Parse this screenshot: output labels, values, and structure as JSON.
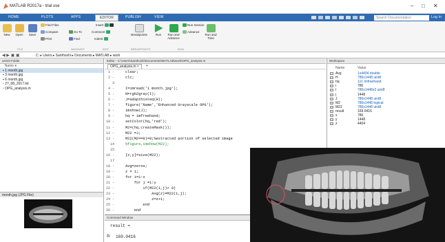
{
  "window": {
    "title": "MATLAB R2017a - trial use"
  },
  "tabs": [
    {
      "label": "HOME"
    },
    {
      "label": "PLOTS"
    },
    {
      "label": "APPS"
    },
    {
      "label": "EDITOR"
    },
    {
      "label": "PUBLISH"
    },
    {
      "label": "VIEW"
    }
  ],
  "search": {
    "placeholder": "Search Documentation"
  },
  "login": "Log In",
  "ribbon": {
    "new": "New",
    "open": "Open",
    "save": "Save",
    "find_files": "Find Files",
    "compare": "Compare",
    "print": "Print",
    "go_to": "Go To",
    "find": "Find",
    "insert": "Insert",
    "comment": "Comment",
    "indent": "Indent",
    "breakpoints": "Breakpoints",
    "run": "Run",
    "run_and_advance": "Run and Advance",
    "run_section": "Run Section",
    "advance": "Advance",
    "run_and_time": "Run and Time",
    "groups": [
      "FILE",
      "NAVIGATE",
      "EDIT",
      "BREAKPOINTS",
      "RUN"
    ]
  },
  "address": {
    "path": [
      "C:",
      "Users",
      "Santhoshi",
      "Documents",
      "MATLAB",
      "work"
    ]
  },
  "current_folder": {
    "title": "urrent Folder",
    "column": "Name",
    "files": [
      "1 month.jpg",
      "3 month.jpg",
      "6 month.jpg",
      "27_08_2017.txt",
      "OPG_analysis.m"
    ],
    "details_file": "month.jpg (JPG File)"
  },
  "editor": {
    "title": "Editor - C:\\Users\\Santhoshi\\Documents\\MATLAB\\work\\OPG_analysis.m",
    "tab": "OPG_analysis.m",
    "lines": [
      {
        "n": "1 -",
        "code": "clear;"
      },
      {
        "n": "2 -",
        "code": "clc;"
      },
      {
        "n": "3",
        "code": ""
      },
      {
        "n": "4 -",
        "code": "I=imread('1 month.jpg');"
      },
      {
        "n": "5 -",
        "code": "H=rgb2gray(I);"
      },
      {
        "n": "6 -",
        "code": "J=adapthisteq(H);"
      },
      {
        "n": "7 -",
        "code": "figure('Name','Enhanced Grayscale OPG');"
      },
      {
        "n": "8 -",
        "code": "imshow(J);"
      },
      {
        "n": "9 -",
        "code": "hq = imfreehand;"
      },
      {
        "n": "10 -",
        "code": "setColor(hq,'red');"
      },
      {
        "n": "11 -",
        "code": "M2=(hq.createMask());"
      },
      {
        "n": "12 -",
        "code": "M22 =J;"
      },
      {
        "n": "13 -",
        "code": "M22(M2==0)=0;%extracted portion of selected image"
      },
      {
        "n": "14",
        "code": "%figure,imshow(M22);"
      },
      {
        "n": "15",
        "code": ""
      },
      {
        "n": "16 -",
        "code": "[x,y]=size(M22);"
      },
      {
        "n": "17",
        "code": ""
      },
      {
        "n": "18 -",
        "code": "Avg=zeros;"
      },
      {
        "n": "19 -",
        "code": "z = 1;"
      },
      {
        "n": "20 -",
        "code": "for i=1:x"
      },
      {
        "n": "21 -",
        "code": "    for j =1:y"
      },
      {
        "n": "22 -",
        "code": "        if(M22(i,j)> 0)"
      },
      {
        "n": "23 -",
        "code": "            Avg(z)=M22(i,j);"
      },
      {
        "n": "24 -",
        "code": "            z=z+1;"
      },
      {
        "n": "25 -",
        "code": "        end"
      },
      {
        "n": "26 -",
        "code": "    end"
      }
    ]
  },
  "command_window": {
    "title": "Command Window",
    "line1": "result =",
    "line2": "169.0416",
    "prompt": "fx"
  },
  "workspace": {
    "title": "Workspace",
    "col_name": "Name",
    "col_value": "Value",
    "vars": [
      {
        "name": "Avg",
        "value": "1x4404 double"
      },
      {
        "name": "H",
        "value": "786x1448 uint8"
      },
      {
        "name": "hq",
        "value": "1x1 imfreehand"
      },
      {
        "name": "i",
        "value": "786"
      },
      {
        "name": "I",
        "value": "786x1448x3 uint8"
      },
      {
        "name": "j",
        "value": "1448"
      },
      {
        "name": "J",
        "value": "786x1448 uint8"
      },
      {
        "name": "M2",
        "value": "786x1448 logical"
      },
      {
        "name": "M22",
        "value": "786x1448 uint8"
      },
      {
        "name": "result",
        "value": "169.0416"
      },
      {
        "name": "x",
        "value": "786"
      },
      {
        "name": "y",
        "value": "1448"
      },
      {
        "name": "z",
        "value": "4404"
      }
    ]
  },
  "colors": {
    "tabbar": "#2e6bb3",
    "code_comment": "#228b22",
    "mask_outline": "#e0506a"
  }
}
